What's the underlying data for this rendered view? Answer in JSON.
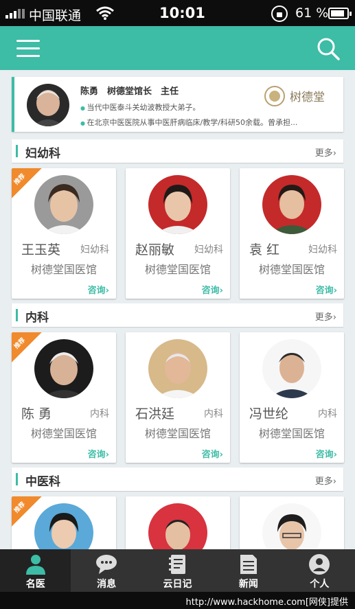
{
  "status_bar": {
    "carrier": "中国联通",
    "time": "10:01",
    "battery": "61 %"
  },
  "featured": {
    "name_line": "陈勇　树德堂馆长　主任",
    "bullets": [
      "当代中医泰斗关幼波教授大弟子。",
      "在北京中医医院从事中医肝病临床/教学/科研50余载。曾承担..."
    ],
    "brand_text": "树德堂"
  },
  "sections": [
    {
      "title": "妇幼科",
      "more": "更多›",
      "doctors": [
        {
          "name": "王玉英",
          "dept": "妇幼科",
          "hospital": "树德堂国医馆",
          "consult": "咨询›",
          "recommended": true,
          "badge": "推荐"
        },
        {
          "name": "赵丽敏",
          "dept": "妇幼科",
          "hospital": "树德堂国医馆",
          "consult": "咨询›",
          "recommended": false
        },
        {
          "name": "袁 红",
          "dept": "妇幼科",
          "hospital": "树德堂国医馆",
          "consult": "咨询›",
          "recommended": false
        }
      ]
    },
    {
      "title": "内科",
      "more": "更多›",
      "doctors": [
        {
          "name": "陈 勇",
          "dept": "内科",
          "hospital": "树德堂国医馆",
          "consult": "咨询›",
          "recommended": true,
          "badge": "推荐"
        },
        {
          "name": "石洪廷",
          "dept": "内科",
          "hospital": "树德堂国医馆",
          "consult": "咨询›",
          "recommended": false
        },
        {
          "name": "冯世纶",
          "dept": "内科",
          "hospital": "树德堂国医馆",
          "consult": "咨询›",
          "recommended": false
        }
      ]
    },
    {
      "title": "中医科",
      "more": "更多›",
      "doctors": [
        {
          "recommended": true,
          "badge": "推荐"
        },
        {
          "recommended": false
        },
        {
          "recommended": false
        }
      ]
    }
  ],
  "tabs": [
    {
      "label": "名医",
      "icon": "doctor-icon",
      "active": true
    },
    {
      "label": "消息",
      "icon": "message-icon",
      "active": false
    },
    {
      "label": "云日记",
      "icon": "diary-icon",
      "active": false
    },
    {
      "label": "新闻",
      "icon": "news-icon",
      "active": false
    },
    {
      "label": "个人",
      "icon": "person-icon",
      "active": false
    }
  ],
  "watermark": "http://www.hackhome.com[网侠]提供",
  "colors": {
    "accent": "#3dbca6",
    "badge": "#f08a2c",
    "tab_bar": "#333333"
  }
}
